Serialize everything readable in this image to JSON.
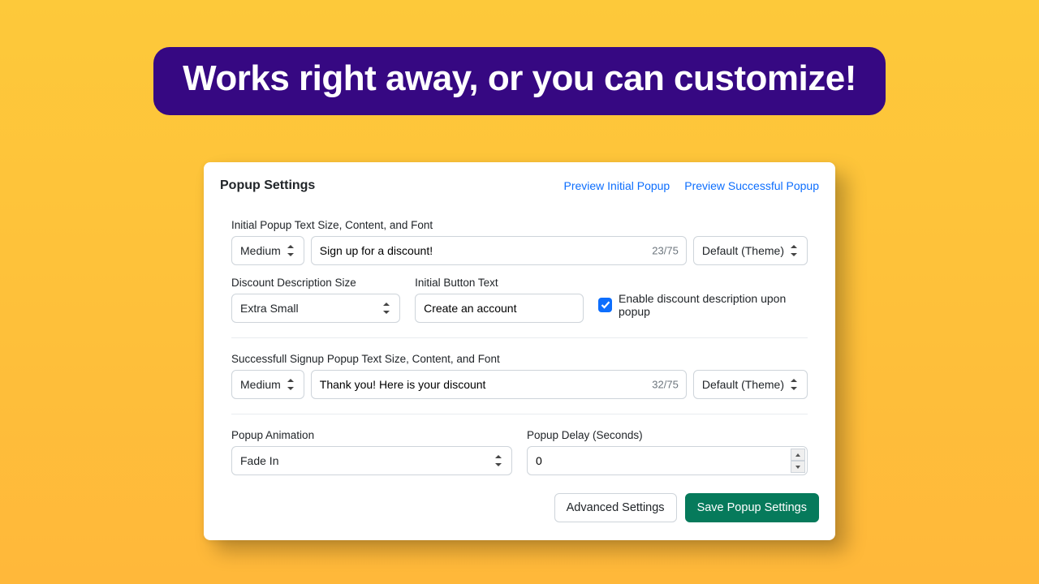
{
  "hero": "Works right away, or you can customize!",
  "panel": {
    "title": "Popup Settings",
    "link_preview_initial": "Preview Initial Popup",
    "link_preview_success": "Preview Successful Popup"
  },
  "initial": {
    "label": "Initial Popup Text Size, Content, and Font",
    "size": "Medium",
    "text": "Sign up for a discount!",
    "counter": "23/75",
    "font": "Default (Theme)",
    "desc_size_label": "Discount Description Size",
    "desc_size": "Extra Small",
    "button_text_label": "Initial Button Text",
    "button_text": "Create an account",
    "enable_desc": "Enable discount description upon popup"
  },
  "success": {
    "label": "Successfull Signup Popup Text Size, Content, and Font",
    "size": "Medium",
    "text": "Thank you! Here is your discount",
    "counter": "32/75",
    "font": "Default (Theme)"
  },
  "anim": {
    "label": "Popup Animation",
    "value": "Fade In",
    "delay_label": "Popup Delay (Seconds)",
    "delay": "0"
  },
  "footer": {
    "advanced": "Advanced Settings",
    "save": "Save Popup Settings"
  }
}
